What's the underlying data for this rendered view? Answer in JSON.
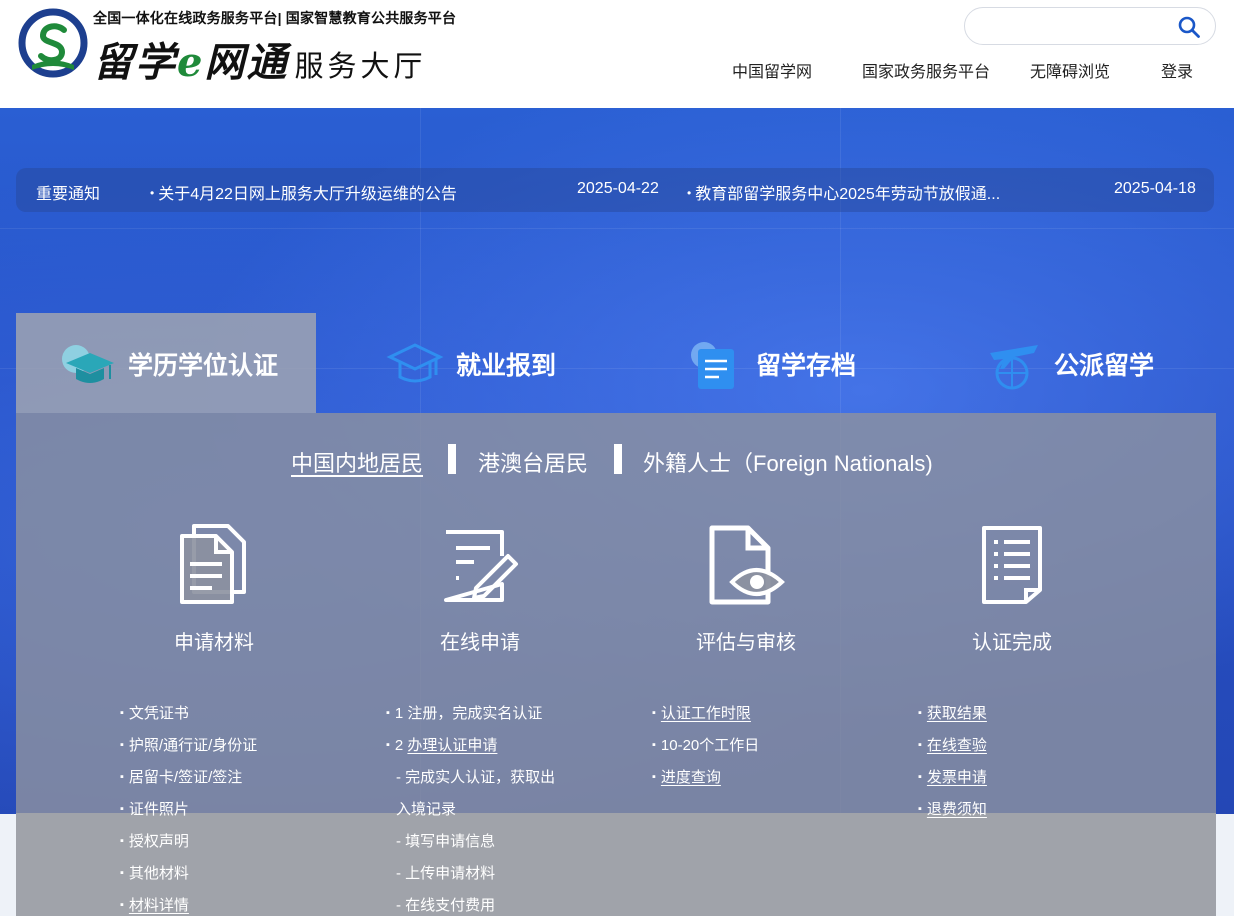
{
  "header": {
    "subtitle": "全国一体化在线政务服务平台| 国家智慧教育公共服务平台",
    "brand_main_a": "留学",
    "brand_e": "e",
    "brand_main_b": "网通",
    "brand_sub": "服务大厅",
    "search_placeholder": "",
    "nav": [
      "中国留学网",
      "国家政务服务平台",
      "无障碍浏览",
      "登录"
    ]
  },
  "notices": {
    "label": "重要通知",
    "items": [
      {
        "title": "关于4月22日网上服务大厅升级运维的公告",
        "date": "2025-04-22"
      },
      {
        "title": "教育部留学服务中心2025年劳动节放假通...",
        "date": "2025-04-18"
      }
    ]
  },
  "tabs": [
    "学历学位认证",
    "就业报到",
    "留学存档",
    "公派留学"
  ],
  "subtabs": [
    "中国内地居民",
    "港澳台居民",
    "外籍人士（Foreign Nationals)"
  ],
  "steps": [
    {
      "title": "申请材料",
      "items": [
        "文凭证书",
        "护照/通行证/身份证",
        "居留卡/签证/签注",
        "证件照片",
        "授权声明",
        "其他材料",
        "材料详情"
      ]
    },
    {
      "title": "在线申请",
      "items": [
        "1 注册，完成实名认证",
        "2 ",
        "办理认证申请",
        "- 完成实人认证，获取出",
        "入境记录",
        "- 填写申请信息",
        "- 上传申请材料",
        "- 在线支付费用"
      ]
    },
    {
      "title": "评估与审核",
      "items": [
        "认证工作时限",
        "10-20个工作日",
        "进度查询"
      ]
    },
    {
      "title": "认证完成",
      "items": [
        "获取结果",
        "在线查验",
        "发票申请",
        "退费须知"
      ]
    }
  ],
  "colors": {
    "banner": "#2752c7",
    "panel": "#8c91a0",
    "accent_green": "#1f8a3a",
    "icon_blue": "#2f8ff0"
  }
}
